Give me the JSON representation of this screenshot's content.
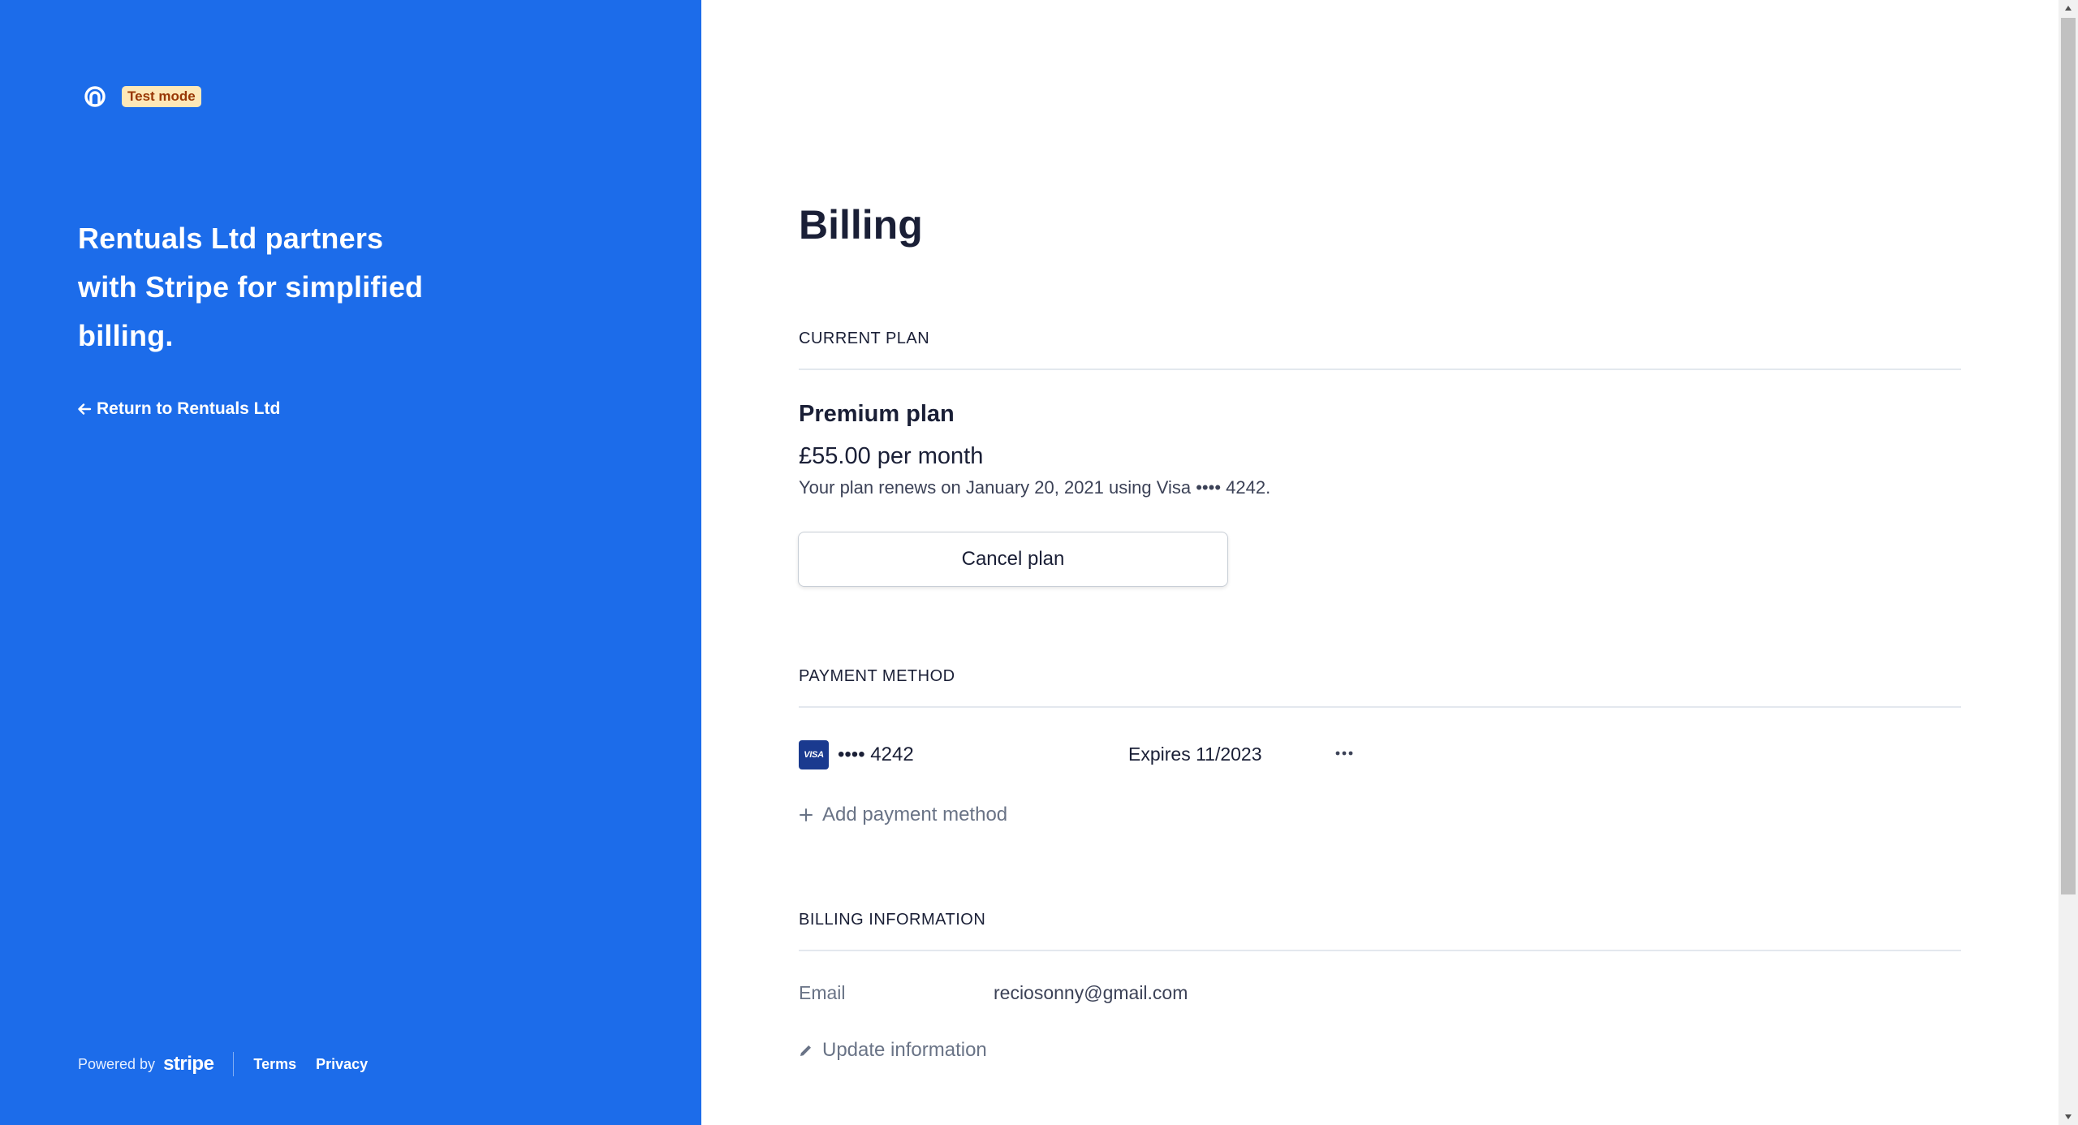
{
  "brand": {
    "test_badge": "Test mode",
    "headline": "Rentuals Ltd partners with Stripe for simplified billing.",
    "return_link": "Return to Rentuals Ltd",
    "accent_color": "#1c6cea"
  },
  "footer": {
    "powered_by": "Powered by",
    "stripe": "stripe",
    "terms": "Terms",
    "privacy": "Privacy"
  },
  "page": {
    "title": "Billing"
  },
  "current_plan": {
    "section_label": "CURRENT PLAN",
    "name": "Premium plan",
    "price": "£55.00 per month",
    "renewal": "Your plan renews on January 20, 2021 using Visa •••• 4242.",
    "cancel_label": "Cancel plan"
  },
  "payment_method": {
    "section_label": "PAYMENT METHOD",
    "card_brand": "VISA",
    "last4": "•••• 4242",
    "expiry": "Expires 11/2023",
    "add_label": "Add payment method"
  },
  "billing_info": {
    "section_label": "BILLING INFORMATION",
    "email_label": "Email",
    "email_value": "reciosonny@gmail.com",
    "update_label": "Update information"
  }
}
